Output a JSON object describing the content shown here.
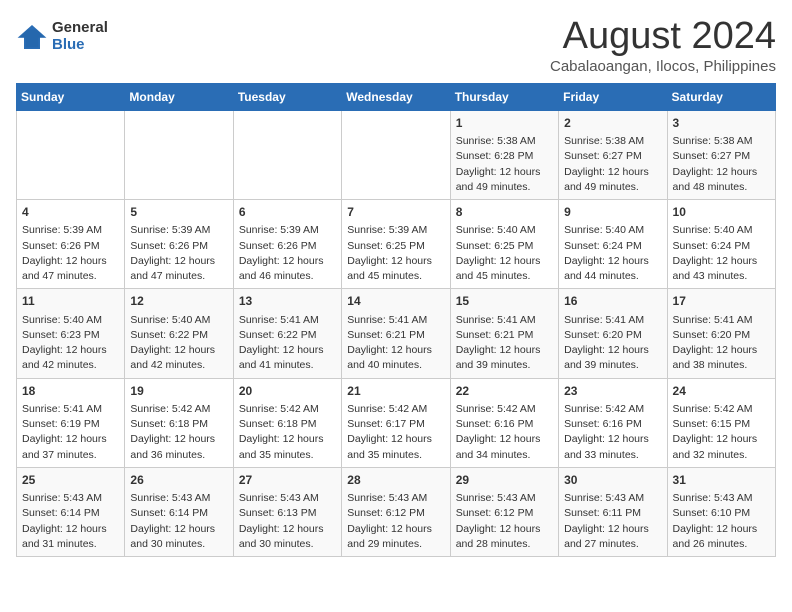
{
  "logo": {
    "general": "General",
    "blue": "Blue"
  },
  "title": "August 2024",
  "subtitle": "Cabalaoangan, Ilocos, Philippines",
  "days_header": [
    "Sunday",
    "Monday",
    "Tuesday",
    "Wednesday",
    "Thursday",
    "Friday",
    "Saturday"
  ],
  "weeks": [
    [
      {
        "day": "",
        "content": ""
      },
      {
        "day": "",
        "content": ""
      },
      {
        "day": "",
        "content": ""
      },
      {
        "day": "",
        "content": ""
      },
      {
        "day": "1",
        "content": "Sunrise: 5:38 AM\nSunset: 6:28 PM\nDaylight: 12 hours\nand 49 minutes."
      },
      {
        "day": "2",
        "content": "Sunrise: 5:38 AM\nSunset: 6:27 PM\nDaylight: 12 hours\nand 49 minutes."
      },
      {
        "day": "3",
        "content": "Sunrise: 5:38 AM\nSunset: 6:27 PM\nDaylight: 12 hours\nand 48 minutes."
      }
    ],
    [
      {
        "day": "4",
        "content": "Sunrise: 5:39 AM\nSunset: 6:26 PM\nDaylight: 12 hours\nand 47 minutes."
      },
      {
        "day": "5",
        "content": "Sunrise: 5:39 AM\nSunset: 6:26 PM\nDaylight: 12 hours\nand 47 minutes."
      },
      {
        "day": "6",
        "content": "Sunrise: 5:39 AM\nSunset: 6:26 PM\nDaylight: 12 hours\nand 46 minutes."
      },
      {
        "day": "7",
        "content": "Sunrise: 5:39 AM\nSunset: 6:25 PM\nDaylight: 12 hours\nand 45 minutes."
      },
      {
        "day": "8",
        "content": "Sunrise: 5:40 AM\nSunset: 6:25 PM\nDaylight: 12 hours\nand 45 minutes."
      },
      {
        "day": "9",
        "content": "Sunrise: 5:40 AM\nSunset: 6:24 PM\nDaylight: 12 hours\nand 44 minutes."
      },
      {
        "day": "10",
        "content": "Sunrise: 5:40 AM\nSunset: 6:24 PM\nDaylight: 12 hours\nand 43 minutes."
      }
    ],
    [
      {
        "day": "11",
        "content": "Sunrise: 5:40 AM\nSunset: 6:23 PM\nDaylight: 12 hours\nand 42 minutes."
      },
      {
        "day": "12",
        "content": "Sunrise: 5:40 AM\nSunset: 6:22 PM\nDaylight: 12 hours\nand 42 minutes."
      },
      {
        "day": "13",
        "content": "Sunrise: 5:41 AM\nSunset: 6:22 PM\nDaylight: 12 hours\nand 41 minutes."
      },
      {
        "day": "14",
        "content": "Sunrise: 5:41 AM\nSunset: 6:21 PM\nDaylight: 12 hours\nand 40 minutes."
      },
      {
        "day": "15",
        "content": "Sunrise: 5:41 AM\nSunset: 6:21 PM\nDaylight: 12 hours\nand 39 minutes."
      },
      {
        "day": "16",
        "content": "Sunrise: 5:41 AM\nSunset: 6:20 PM\nDaylight: 12 hours\nand 39 minutes."
      },
      {
        "day": "17",
        "content": "Sunrise: 5:41 AM\nSunset: 6:20 PM\nDaylight: 12 hours\nand 38 minutes."
      }
    ],
    [
      {
        "day": "18",
        "content": "Sunrise: 5:41 AM\nSunset: 6:19 PM\nDaylight: 12 hours\nand 37 minutes."
      },
      {
        "day": "19",
        "content": "Sunrise: 5:42 AM\nSunset: 6:18 PM\nDaylight: 12 hours\nand 36 minutes."
      },
      {
        "day": "20",
        "content": "Sunrise: 5:42 AM\nSunset: 6:18 PM\nDaylight: 12 hours\nand 35 minutes."
      },
      {
        "day": "21",
        "content": "Sunrise: 5:42 AM\nSunset: 6:17 PM\nDaylight: 12 hours\nand 35 minutes."
      },
      {
        "day": "22",
        "content": "Sunrise: 5:42 AM\nSunset: 6:16 PM\nDaylight: 12 hours\nand 34 minutes."
      },
      {
        "day": "23",
        "content": "Sunrise: 5:42 AM\nSunset: 6:16 PM\nDaylight: 12 hours\nand 33 minutes."
      },
      {
        "day": "24",
        "content": "Sunrise: 5:42 AM\nSunset: 6:15 PM\nDaylight: 12 hours\nand 32 minutes."
      }
    ],
    [
      {
        "day": "25",
        "content": "Sunrise: 5:43 AM\nSunset: 6:14 PM\nDaylight: 12 hours\nand 31 minutes."
      },
      {
        "day": "26",
        "content": "Sunrise: 5:43 AM\nSunset: 6:14 PM\nDaylight: 12 hours\nand 30 minutes."
      },
      {
        "day": "27",
        "content": "Sunrise: 5:43 AM\nSunset: 6:13 PM\nDaylight: 12 hours\nand 30 minutes."
      },
      {
        "day": "28",
        "content": "Sunrise: 5:43 AM\nSunset: 6:12 PM\nDaylight: 12 hours\nand 29 minutes."
      },
      {
        "day": "29",
        "content": "Sunrise: 5:43 AM\nSunset: 6:12 PM\nDaylight: 12 hours\nand 28 minutes."
      },
      {
        "day": "30",
        "content": "Sunrise: 5:43 AM\nSunset: 6:11 PM\nDaylight: 12 hours\nand 27 minutes."
      },
      {
        "day": "31",
        "content": "Sunrise: 5:43 AM\nSunset: 6:10 PM\nDaylight: 12 hours\nand 26 minutes."
      }
    ]
  ]
}
